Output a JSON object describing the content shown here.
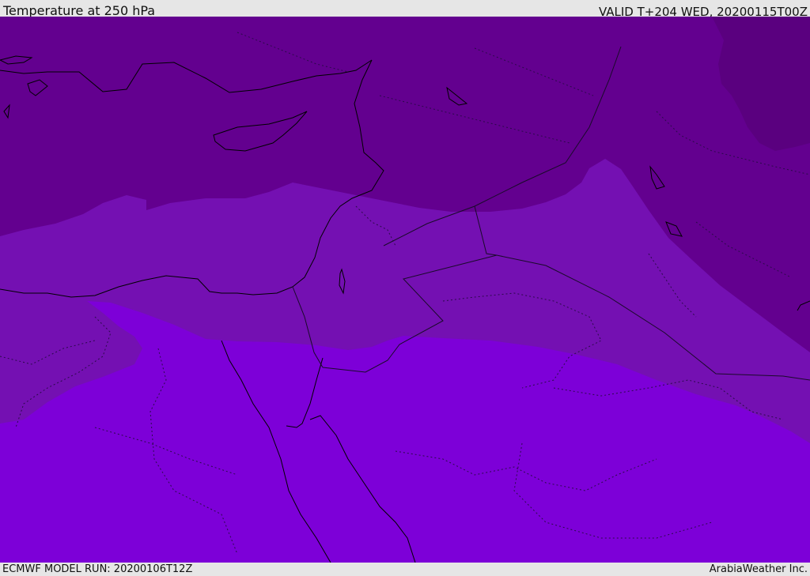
{
  "header": {
    "title": "Temperature at 250 hPa",
    "valid_time": "VALID T+204 WED, 20200115T00Z"
  },
  "footer": {
    "model_run": "ECMWF MODEL RUN: 20200106T12Z",
    "credit": "ArabiaWeather Inc."
  },
  "map": {
    "field": "temperature",
    "pressure_level_hpa": 250,
    "color_bands": [
      "#5a007f",
      "#63008f",
      "#7410b2",
      "#7d00d8"
    ],
    "coastline_color": "#000000",
    "border_color": "#1a0a2a"
  }
}
